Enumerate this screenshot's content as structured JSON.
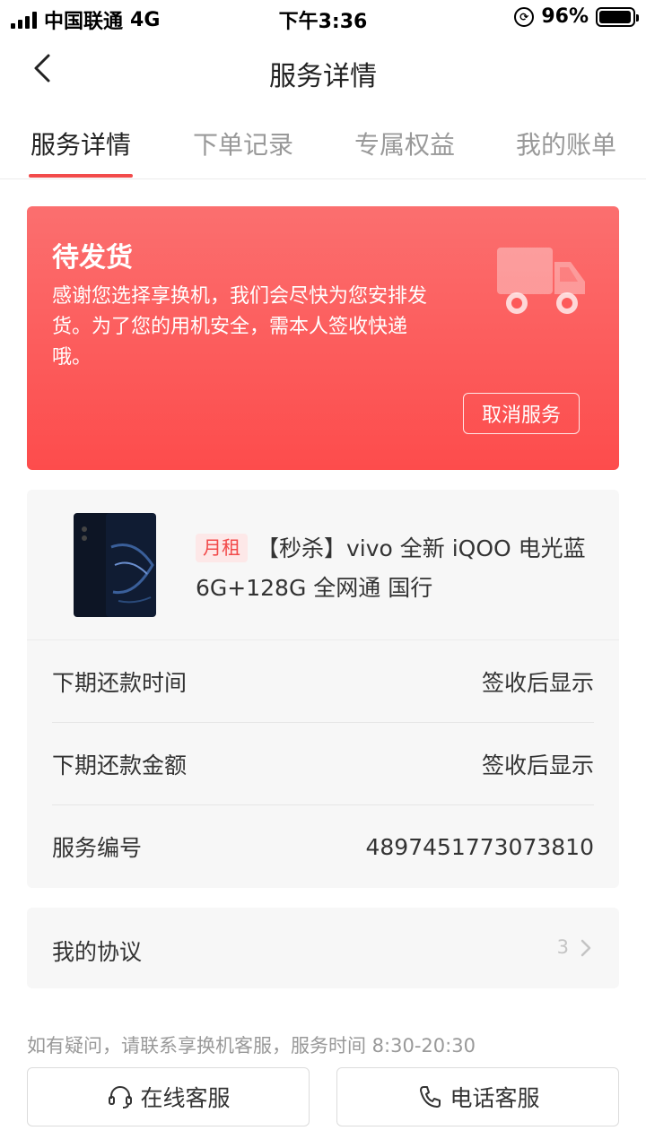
{
  "status_bar": {
    "carrier": "中国联通",
    "network": "4G",
    "time": "下午3:36",
    "battery": "96%",
    "battery_level": 0.96
  },
  "nav": {
    "title": "服务详情"
  },
  "tabs": [
    {
      "label": "服务详情",
      "active": true
    },
    {
      "label": "下单记录",
      "active": false
    },
    {
      "label": "专属权益",
      "active": false
    },
    {
      "label": "我的账单",
      "active": false
    }
  ],
  "status_card": {
    "title": "待发货",
    "description": "感谢您选择享换机，我们会尽快为您安排发货。为了您的用机安全，需本人签收快递哦。",
    "cancel_label": "取消服务",
    "icon": "truck-icon"
  },
  "product": {
    "tag": "月租",
    "name": "【秒杀】vivo 全新 iQOO 电光蓝 6G+128G 全网通 国行",
    "rows": [
      {
        "label": "下期还款时间",
        "value": "签收后显示"
      },
      {
        "label": "下期还款金额",
        "value": "签收后显示"
      },
      {
        "label": "服务编号",
        "value": "4897451773073810"
      }
    ]
  },
  "agreement": {
    "label": "我的协议",
    "count": "3"
  },
  "footer": {
    "help_text": "如有疑问，请联系享换机客服，服务时间 8:30-20:30",
    "online_label": "在线客服",
    "phone_label": "电话客服"
  },
  "colors": {
    "accent": "#f24b4b",
    "card_gradient_top": "#fb6f6f",
    "card_gradient_bottom": "#fd4c4c"
  }
}
